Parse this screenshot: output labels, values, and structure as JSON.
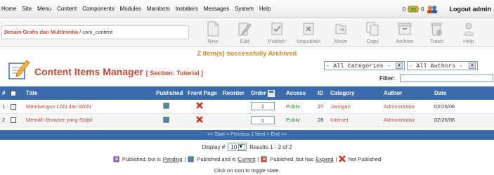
{
  "menu": [
    "Home",
    "Site",
    "Menu",
    "Content",
    "Components",
    "Modules",
    "Mambots",
    "Installers",
    "Messages",
    "System",
    "Help"
  ],
  "topright": {
    "messages_count": "0",
    "users_count": "0",
    "logout": "Logout admin"
  },
  "pathway": {
    "site": "Desain Grafis dan Multimedia",
    "path": " / com_content"
  },
  "toolbar": [
    "New",
    "Edit",
    "Publish",
    "Unpublish",
    "Move",
    "Copy",
    "Archive",
    "Trash",
    "Help"
  ],
  "message": "2 Item(s) successfully Archived",
  "header": {
    "title": "Content Items Manager",
    "section": "[ Section: Tutorial ]"
  },
  "filters": {
    "categories": "- All Categories -",
    "authors": "- All Authors -",
    "filter_label": "Filter:"
  },
  "columns": {
    "num": "#",
    "title": "Title",
    "published": "Published",
    "frontpage": "Front Page",
    "reorder": "Reorder",
    "order": "Order",
    "access": "Access",
    "id": "ID",
    "category": "Category",
    "author": "Author",
    "date": "Date"
  },
  "rows": [
    {
      "num": "1",
      "title": "Membangun LAN dan WAN",
      "order": "1",
      "access": "Public",
      "id": "27",
      "category": "Jaringan",
      "author": "Administrator",
      "date": "02/26/06"
    },
    {
      "num": "2",
      "title": "Memilih Browser yang Stabil",
      "order": "1",
      "access": "Public",
      "id": "28",
      "category": "Internet",
      "author": "Administrator",
      "date": "02/26/06"
    }
  ],
  "pagination": "<< Start < Previous 1 Next > End >>",
  "display": {
    "label": "Display #",
    "value": "10",
    "results": "Results 1 - 2 of 2"
  },
  "legend": {
    "pending_prefix": "Published, but is",
    "pending": "Pending",
    "current_prefix": "Published and is",
    "current": "Current",
    "expired_prefix": "Published, but has",
    "expired": "Expired",
    "not_published": "Not Published"
  },
  "toggle_note": "Click on icon to toggle state.",
  "colors": {
    "accent": "#c64934",
    "header_blue": "#3c6bab",
    "message": "#d58a1c"
  }
}
